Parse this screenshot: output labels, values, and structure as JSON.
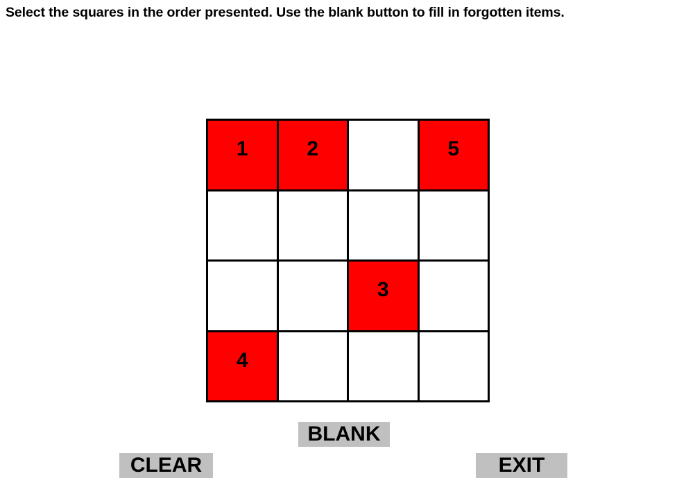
{
  "header": {
    "instruction": "Select the squares in the order presented. Use the blank button to fill in forgotten items."
  },
  "colors": {
    "filled_cell": "#FF0000",
    "empty_cell": "#FFFFFF",
    "cell_border": "#000000",
    "button_background": "#C0C0C0",
    "text": "#000000"
  },
  "grid": {
    "rows": 4,
    "columns": 4,
    "cells": [
      [
        {
          "label": "1",
          "filled": true
        },
        {
          "label": "2",
          "filled": true
        },
        {
          "label": "",
          "filled": false
        },
        {
          "label": "5",
          "filled": true
        }
      ],
      [
        {
          "label": "",
          "filled": false
        },
        {
          "label": "",
          "filled": false
        },
        {
          "label": "",
          "filled": false
        },
        {
          "label": "",
          "filled": false
        }
      ],
      [
        {
          "label": "",
          "filled": false
        },
        {
          "label": "",
          "filled": false
        },
        {
          "label": "3",
          "filled": true
        },
        {
          "label": "",
          "filled": false
        }
      ],
      [
        {
          "label": "4",
          "filled": true
        },
        {
          "label": "",
          "filled": false
        },
        {
          "label": "",
          "filled": false
        },
        {
          "label": "",
          "filled": false
        }
      ]
    ]
  },
  "buttons": {
    "blank": "BLANK",
    "clear": "CLEAR",
    "exit": "EXIT"
  }
}
